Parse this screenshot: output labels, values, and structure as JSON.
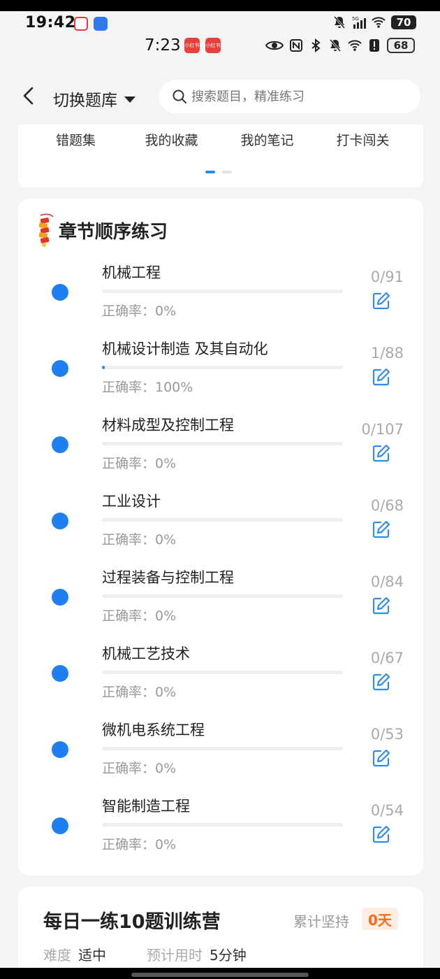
{
  "status_bar": {
    "time": "19:42",
    "battery": "70",
    "network": "5G"
  },
  "status_bar_inner": {
    "time": "7:23",
    "mini_app_label": "小红书",
    "battery": "68"
  },
  "header": {
    "back_icon": "chevron-left-icon",
    "switch_label": "切换题库",
    "search_placeholder": "搜索题目，精准练习"
  },
  "tools": {
    "items": [
      {
        "label": "错题集"
      },
      {
        "label": "我的收藏"
      },
      {
        "label": "我的笔记"
      },
      {
        "label": "打卡闯关"
      }
    ],
    "page_indicator": {
      "pages": 2,
      "active": 0
    }
  },
  "chapters": {
    "title": "章节顺序练习",
    "accent": "#1e7ff0",
    "items": [
      {
        "name": "机械工程",
        "count": "0/91",
        "rate": "正确率：0%",
        "progress": 0.0
      },
      {
        "name": "机械设计制造 及其自动化",
        "count": "1/88",
        "rate": "正确率：100%",
        "progress": 0.011
      },
      {
        "name": "材料成型及控制工程",
        "count": "0/107",
        "rate": "正确率：0%",
        "progress": 0.0
      },
      {
        "name": "工业设计",
        "count": "0/68",
        "rate": "正确率：0%",
        "progress": 0.0
      },
      {
        "name": "过程装备与控制工程",
        "count": "0/84",
        "rate": "正确率：0%",
        "progress": 0.0
      },
      {
        "name": "机械工艺技术",
        "count": "0/67",
        "rate": "正确率：0%",
        "progress": 0.0
      },
      {
        "name": "微机电系统工程",
        "count": "0/53",
        "rate": "正确率：0%",
        "progress": 0.0
      },
      {
        "name": "智能制造工程",
        "count": "0/54",
        "rate": "正确率：0%",
        "progress": 0.0
      }
    ]
  },
  "daily": {
    "title": "每日一练10题训练营",
    "persist_label": "累计坚持",
    "persist_value": "0天",
    "difficulty_label": "难度",
    "difficulty_value": "适中",
    "time_label": "预计用时",
    "time_value": "5分钟",
    "badge_color": "#ff6a1a"
  }
}
